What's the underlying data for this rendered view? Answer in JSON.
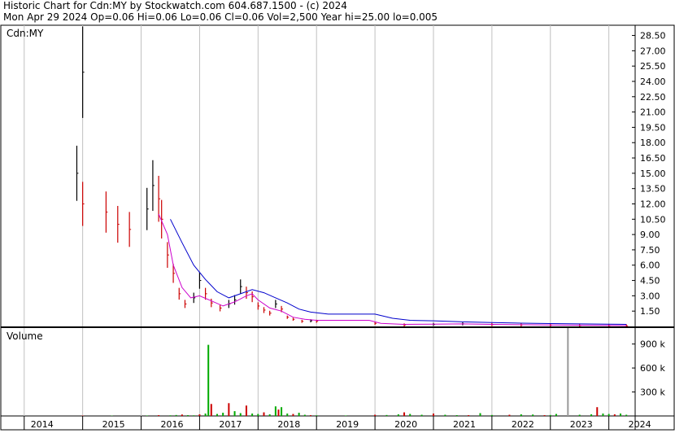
{
  "header": {
    "line1": "Historic Chart for Cdn:MY by Stockwatch.com 604.687.1500 - (c) 2024",
    "line2": "Mon Apr 29 2024  Op=0.06  Hi=0.06  Lo=0.06  Cl=0.06  Vol=2,500  Year hi=25.00  lo=0.005"
  },
  "colors": {
    "ma_short": "#cc00cc",
    "ma_long": "#0000cc",
    "price_up": "#000000",
    "price_down": "#cc0000",
    "vol_up": "#00aa00",
    "vol_down": "#cc0000",
    "grid": "#c0c0c0"
  },
  "chart_data": [
    {
      "type": "line",
      "title": "Cdn:MY",
      "xlabel": "",
      "ylabel": "",
      "ylim": [
        0,
        29.5
      ],
      "y_ticks": [
        "28.50",
        "27.00",
        "25.50",
        "24.00",
        "22.50",
        "21.00",
        "19.50",
        "18.00",
        "16.50",
        "15.00",
        "13.50",
        "12.00",
        "10.50",
        "9.00",
        "7.50",
        "6.00",
        "4.50",
        "3.00",
        "1.50"
      ],
      "x_ticks": [
        "2014",
        "2015",
        "2016",
        "2017",
        "2018",
        "2019",
        "2020",
        "2021",
        "2022",
        "2023",
        "2024"
      ],
      "grid": true,
      "series": [
        {
          "name": "",
          "values": [
            [
              2014.9,
              15.0
            ],
            [
              2015.0,
              24.9
            ],
            [
              2015.0,
              12.0
            ],
            [
              2015.4,
              11.2
            ],
            [
              2015.6,
              10.0
            ],
            [
              2015.8,
              9.5
            ],
            [
              2016.1,
              11.5
            ],
            [
              2016.2,
              13.8
            ],
            [
              2016.3,
              12.5
            ],
            [
              2016.35,
              10.5
            ],
            [
              2016.45,
              7.0
            ],
            [
              2016.55,
              5.2
            ],
            [
              2016.65,
              3.2
            ],
            [
              2016.75,
              2.2
            ],
            [
              2016.9,
              2.8
            ],
            [
              2017.0,
              4.5
            ],
            [
              2017.1,
              3.2
            ],
            [
              2017.2,
              2.3
            ],
            [
              2017.35,
              1.8
            ],
            [
              2017.5,
              2.2
            ],
            [
              2017.6,
              2.6
            ],
            [
              2017.7,
              3.9
            ],
            [
              2017.8,
              3.3
            ],
            [
              2017.9,
              2.9
            ],
            [
              2018.0,
              2.0
            ],
            [
              2018.1,
              1.6
            ],
            [
              2018.2,
              1.3
            ],
            [
              2018.3,
              2.2
            ],
            [
              2018.4,
              1.7
            ],
            [
              2018.5,
              0.9
            ],
            [
              2018.6,
              0.7
            ],
            [
              2018.75,
              0.5
            ],
            [
              2018.9,
              0.55
            ],
            [
              2019.0,
              0.5
            ],
            [
              2020.0,
              0.3
            ],
            [
              2020.5,
              0.15
            ],
            [
              2021.0,
              0.2
            ],
            [
              2021.5,
              0.25
            ],
            [
              2022.0,
              0.18
            ],
            [
              2022.5,
              0.15
            ],
            [
              2023.0,
              0.12
            ],
            [
              2023.5,
              0.1
            ],
            [
              2024.0,
              0.08
            ],
            [
              2024.3,
              0.06
            ]
          ]
        },
        {
          "name": "",
          "values": [
            [
              2016.3,
              11.0
            ],
            [
              2016.45,
              9.0
            ],
            [
              2016.55,
              6.0
            ],
            [
              2016.7,
              3.8
            ],
            [
              2016.85,
              2.8
            ],
            [
              2017.0,
              3.0
            ],
            [
              2017.2,
              2.5
            ],
            [
              2017.4,
              2.0
            ],
            [
              2017.6,
              2.4
            ],
            [
              2017.8,
              3.0
            ],
            [
              2017.9,
              3.2
            ],
            [
              2018.0,
              2.6
            ],
            [
              2018.2,
              1.8
            ],
            [
              2018.4,
              1.5
            ],
            [
              2018.6,
              0.9
            ],
            [
              2018.8,
              0.7
            ],
            [
              2019.0,
              0.6
            ],
            [
              2019.9,
              0.6
            ],
            [
              2020.1,
              0.3
            ],
            [
              2020.5,
              0.2
            ],
            [
              2021.0,
              0.22
            ],
            [
              2021.5,
              0.25
            ],
            [
              2022.0,
              0.2
            ],
            [
              2022.5,
              0.17
            ],
            [
              2023.0,
              0.14
            ],
            [
              2023.5,
              0.12
            ],
            [
              2024.0,
              0.1
            ],
            [
              2024.3,
              0.08
            ]
          ]
        },
        {
          "name": "",
          "values": [
            [
              2016.5,
              10.5
            ],
            [
              2016.7,
              8.2
            ],
            [
              2016.9,
              6.0
            ],
            [
              2017.1,
              4.6
            ],
            [
              2017.3,
              3.4
            ],
            [
              2017.5,
              2.8
            ],
            [
              2017.7,
              3.2
            ],
            [
              2017.9,
              3.6
            ],
            [
              2018.1,
              3.3
            ],
            [
              2018.3,
              2.8
            ],
            [
              2018.5,
              2.3
            ],
            [
              2018.7,
              1.7
            ],
            [
              2018.9,
              1.4
            ],
            [
              2019.2,
              1.2
            ],
            [
              2019.6,
              1.2
            ],
            [
              2020.0,
              1.2
            ],
            [
              2020.3,
              0.8
            ],
            [
              2020.6,
              0.6
            ],
            [
              2021.0,
              0.55
            ],
            [
              2021.5,
              0.45
            ],
            [
              2022.0,
              0.38
            ],
            [
              2022.5,
              0.32
            ],
            [
              2023.0,
              0.28
            ],
            [
              2023.5,
              0.25
            ],
            [
              2024.0,
              0.22
            ],
            [
              2024.3,
              0.2
            ]
          ]
        }
      ]
    },
    {
      "type": "bar",
      "title": "Volume",
      "ylim": [
        0,
        1100
      ],
      "y_ticks": [
        "900 k",
        "600 k",
        "300 k"
      ],
      "values": [
        [
          2015.0,
          5
        ],
        [
          2015.5,
          4
        ],
        [
          2016.1,
          6
        ],
        [
          2016.3,
          10
        ],
        [
          2016.5,
          8
        ],
        [
          2016.6,
          12
        ],
        [
          2016.7,
          18
        ],
        [
          2016.8,
          10
        ],
        [
          2016.9,
          8
        ],
        [
          2017.0,
          20
        ],
        [
          2017.1,
          30
        ],
        [
          2017.15,
          890
        ],
        [
          2017.2,
          150
        ],
        [
          2017.3,
          25
        ],
        [
          2017.4,
          40
        ],
        [
          2017.5,
          160
        ],
        [
          2017.6,
          60
        ],
        [
          2017.7,
          35
        ],
        [
          2017.8,
          130
        ],
        [
          2017.9,
          30
        ],
        [
          2018.0,
          25
        ],
        [
          2018.1,
          45
        ],
        [
          2018.2,
          20
        ],
        [
          2018.3,
          120
        ],
        [
          2018.35,
          80
        ],
        [
          2018.4,
          110
        ],
        [
          2018.5,
          30
        ],
        [
          2018.6,
          25
        ],
        [
          2018.7,
          40
        ],
        [
          2018.8,
          15
        ],
        [
          2018.9,
          10
        ],
        [
          2019.0,
          8
        ],
        [
          2019.5,
          6
        ],
        [
          2020.0,
          15
        ],
        [
          2020.2,
          12
        ],
        [
          2020.4,
          20
        ],
        [
          2020.5,
          45
        ],
        [
          2020.6,
          25
        ],
        [
          2020.8,
          15
        ],
        [
          2021.0,
          30
        ],
        [
          2021.2,
          15
        ],
        [
          2021.4,
          10
        ],
        [
          2021.6,
          10
        ],
        [
          2021.8,
          35
        ],
        [
          2022.0,
          12
        ],
        [
          2022.3,
          15
        ],
        [
          2022.5,
          20
        ],
        [
          2022.7,
          18
        ],
        [
          2022.9,
          10
        ],
        [
          2023.0,
          12
        ],
        [
          2023.1,
          25
        ],
        [
          2023.3,
          1100
        ],
        [
          2023.5,
          15
        ],
        [
          2023.7,
          20
        ],
        [
          2023.8,
          110
        ],
        [
          2023.9,
          30
        ],
        [
          2024.0,
          25
        ],
        [
          2024.1,
          20
        ],
        [
          2024.2,
          30
        ],
        [
          2024.3,
          15
        ]
      ]
    }
  ]
}
